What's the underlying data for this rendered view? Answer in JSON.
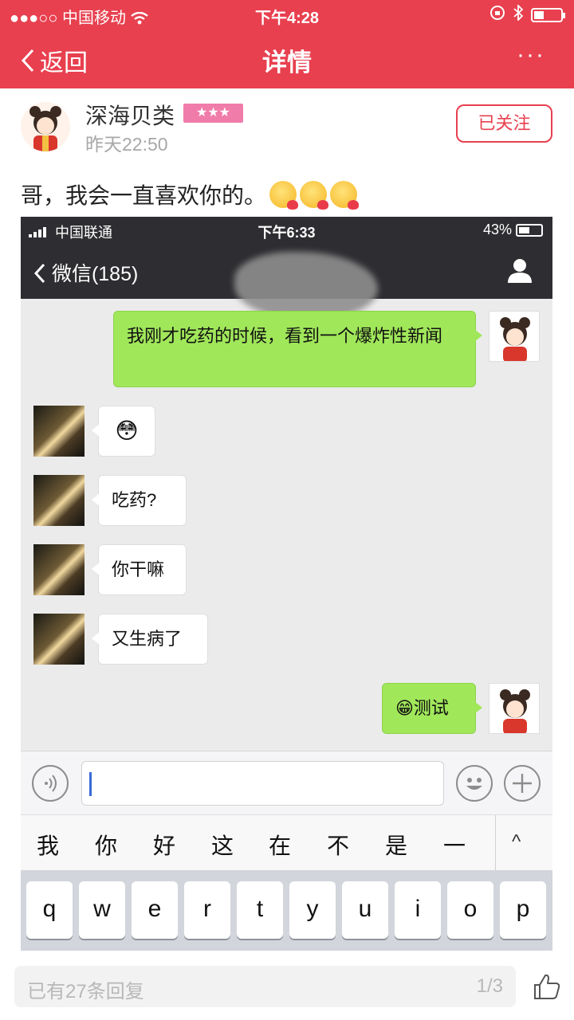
{
  "status_bar": {
    "signal": "●●●○○",
    "carrier": "中国移动",
    "time": "下午4:28"
  },
  "nav": {
    "back_label": "返回",
    "title": "详情",
    "more_label": "···"
  },
  "post": {
    "author": "深海贝类",
    "stars": "★★★",
    "time": "昨天22:50",
    "follow_label": "已关注",
    "text": "哥，我会一直喜欢你的。"
  },
  "screenshot": {
    "status": {
      "carrier": "中国联通",
      "time": "下午6:33",
      "battery": "43%"
    },
    "nav": {
      "back_label": "微信(185)"
    },
    "messages": [
      {
        "side": "me",
        "text": "我刚才吃药的时候，看到一个爆炸性新闻"
      },
      {
        "side": "them",
        "text": "😳"
      },
      {
        "side": "them",
        "text": "吃药?"
      },
      {
        "side": "them",
        "text": "你干嘛"
      },
      {
        "side": "them",
        "text": "又生病了"
      },
      {
        "side": "me",
        "text": "😁测试"
      }
    ],
    "candidates": [
      "我",
      "你",
      "好",
      "这",
      "在",
      "不",
      "是",
      "一"
    ],
    "candidate_toggle": "^",
    "keys": [
      "q",
      "w",
      "e",
      "r",
      "t",
      "y",
      "u",
      "i",
      "o",
      "p"
    ]
  },
  "reply_bar": {
    "placeholder": "已有27条回复",
    "page": "1/3"
  },
  "colors": {
    "brand_red": "#e8404f",
    "bubble_green": "#a0e75a",
    "wechat_dark": "#2e2e32",
    "star_badge": "#f07caa"
  }
}
